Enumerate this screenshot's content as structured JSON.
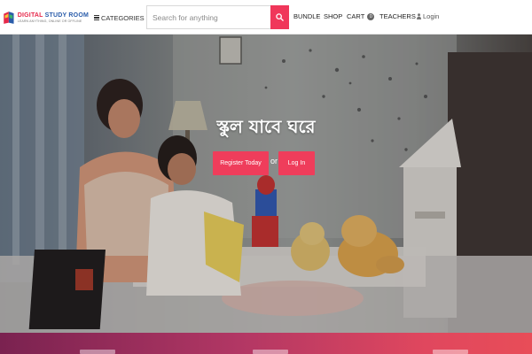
{
  "brand": {
    "name_part1": "DIGITAL ",
    "name_part2": "STUDY ROOM",
    "tagline": "LEARN ANYTHING, ONLINE OR OFFLINE",
    "logo_icon": "book-logo-icon"
  },
  "header": {
    "categories_label": "CATEGORIES",
    "search": {
      "placeholder": "Search for anything",
      "value": ""
    },
    "nav": {
      "bundle": "BUNDLE",
      "shop": "SHOP",
      "cart": "CART",
      "cart_count": "0",
      "teachers": "TEACHERS",
      "login": "Login"
    }
  },
  "hero": {
    "title": "স্কুল যাবে ঘরে",
    "register_label": "Register Today",
    "or_label": "or",
    "login_label": "Log In"
  },
  "colors": {
    "accent": "#ef3d5b",
    "brand_blue": "#2a5caa",
    "band_start": "#7a2250",
    "band_end": "#e84d58"
  }
}
